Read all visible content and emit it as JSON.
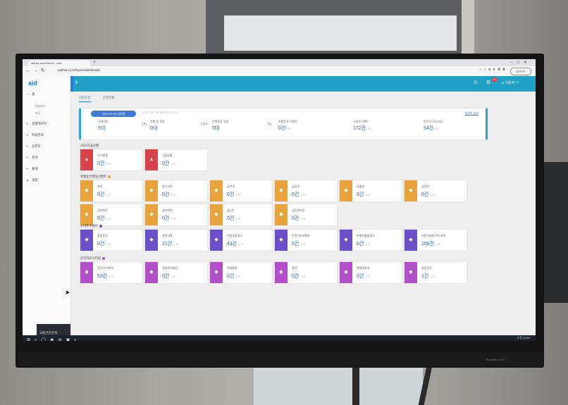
{
  "browser": {
    "tab_title": "aidrive.co.kr/home · web",
    "url": "aidrive.co.kr/home/dashboard",
    "update_button": "업데이트"
  },
  "sidebar": {
    "logo": "aid",
    "items": [
      {
        "label": "홈",
        "icon": "home-icon"
      },
      {
        "label": "운행데이터",
        "icon": "car-icon"
      },
      {
        "label": "차량관리",
        "icon": "bus-icon"
      },
      {
        "label": "운전자",
        "icon": "person-icon"
      },
      {
        "label": "분석",
        "icon": "chart-icon"
      },
      {
        "label": "통계",
        "icon": "doc-icon"
      },
      {
        "label": "설정",
        "icon": "bell-icon"
      }
    ],
    "sub_items": [
      "대시보드",
      "지도"
    ],
    "banner": "교통안전관제"
  },
  "header": {
    "user_label": "사용자 ∨",
    "alert_count": "10"
  },
  "tabs": [
    "안전운전",
    "운행현황"
  ],
  "status": {
    "date": "2022-07-08 금요일",
    "note": "실시간 차량 운행 현황 데이터입니다",
    "detail_link": "자세히 보기",
    "items": [
      {
        "label": "전체차량",
        "value": "5대",
        "tag": ""
      },
      {
        "label": "운행 중 차량",
        "value": "0대",
        "tag": "ON"
      },
      {
        "label": "운행종료 차량",
        "value": "5대",
        "tag": "OFF"
      },
      {
        "label": "위험운전 이벤트",
        "value": "0건",
        "unit": "누적",
        "tag": "TS"
      },
      {
        "label": "스마트이벤트",
        "value": "172건",
        "unit": "누적",
        "tag": ""
      },
      {
        "label": "운전자 모니터링",
        "value": "54건",
        "unit": "누적",
        "tag": ""
      }
    ]
  },
  "sections": [
    {
      "title": "사고/긴급상황",
      "dot": "",
      "cards": [
        {
          "label": "사고발생",
          "value": "0건",
          "unit": "누적",
          "color": "#d9434a",
          "icon": "warning-icon"
        },
        {
          "label": "긴급상황",
          "value": "0건",
          "unit": "누적",
          "color": "#d9434a",
          "icon": "warning-icon"
        }
      ]
    },
    {
      "title": "위험운전행동이벤트",
      "dot": "#e8a33d",
      "cards": [
        {
          "label": "과속",
          "value": "0건",
          "unit": "누적",
          "color": "#e8a33d",
          "icon": "car-icon"
        },
        {
          "label": "장기과속",
          "value": "0건",
          "unit": "누적",
          "color": "#e8a33d",
          "icon": "car-icon"
        },
        {
          "label": "급가속",
          "value": "0건",
          "unit": "누적",
          "color": "#e8a33d",
          "icon": "car-icon"
        },
        {
          "label": "급감속",
          "value": "0건",
          "unit": "누적",
          "color": "#e8a33d",
          "icon": "car-icon"
        },
        {
          "label": "급출발",
          "value": "0건",
          "unit": "누적",
          "color": "#e8a33d",
          "icon": "car-icon"
        },
        {
          "label": "급정지",
          "value": "0건",
          "unit": "누적",
          "color": "#e8a33d",
          "icon": "car-icon"
        },
        {
          "label": "급좌회전",
          "value": "0건",
          "unit": "누적",
          "color": "#e8a33d",
          "icon": "turn-icon"
        },
        {
          "label": "급우회전",
          "value": "0건",
          "unit": "누적",
          "color": "#e8a33d",
          "icon": "turn-icon"
        },
        {
          "label": "급U턴",
          "value": "0건",
          "unit": "누적",
          "color": "#e8a33d",
          "icon": "uturn-icon"
        },
        {
          "label": "급진로변경",
          "value": "0건",
          "unit": "누적",
          "color": "#e8a33d",
          "icon": "lane-icon"
        }
      ]
    },
    {
      "title": "스마트이벤트",
      "dot": "#6a4fc9",
      "cards": [
        {
          "label": "졸음운전",
          "value": "0건",
          "unit": "누적",
          "color": "#6a4fc9",
          "icon": "sleep-icon"
        },
        {
          "label": "차선이탈",
          "value": "21건",
          "unit": "누적",
          "color": "#6a4fc9",
          "icon": "lane-icon"
        },
        {
          "label": "전방추돌경고",
          "value": "43건",
          "unit": "누적",
          "color": "#6a4fc9",
          "icon": "collision-icon"
        },
        {
          "label": "안전거리미확보",
          "value": "0건",
          "unit": "누적",
          "color": "#6a4fc9",
          "icon": "distance-icon"
        },
        {
          "label": "보행자충돌경고",
          "value": "0건",
          "unit": "누적",
          "color": "#6a4fc9",
          "icon": "pedestrian-icon"
        },
        {
          "label": "어린이보호구역 과속",
          "value": "108건",
          "unit": "누적",
          "color": "#6a4fc9",
          "icon": "crosswalk-icon"
        }
      ]
    },
    {
      "title": "운전자모니터링",
      "dot": "#b34fc9",
      "cards": [
        {
          "label": "운전자 미착석",
          "value": "53건",
          "unit": "누적",
          "color": "#b34fc9",
          "icon": "seat-icon"
        },
        {
          "label": "전방주시태만",
          "value": "0건",
          "unit": "누적",
          "color": "#b34fc9",
          "icon": "eye-icon"
        },
        {
          "label": "전화통화",
          "value": "0건",
          "unit": "누적",
          "color": "#b34fc9",
          "icon": "phone-icon"
        },
        {
          "label": "흡연",
          "value": "0건",
          "unit": "누적",
          "color": "#b34fc9",
          "icon": "smoke-icon"
        },
        {
          "label": "핸들미조작",
          "value": "0건",
          "unit": "누적",
          "color": "#b34fc9",
          "icon": "wheel-icon"
        },
        {
          "label": "졸음운전",
          "value": "1건",
          "unit": "누적",
          "color": "#b34fc9",
          "icon": "wheel-icon"
        }
      ]
    }
  ],
  "taskbar": {
    "time": "오전 10:54",
    "date": "2022-07-11"
  },
  "monitor": {
    "brand": "SAMSUNG"
  }
}
